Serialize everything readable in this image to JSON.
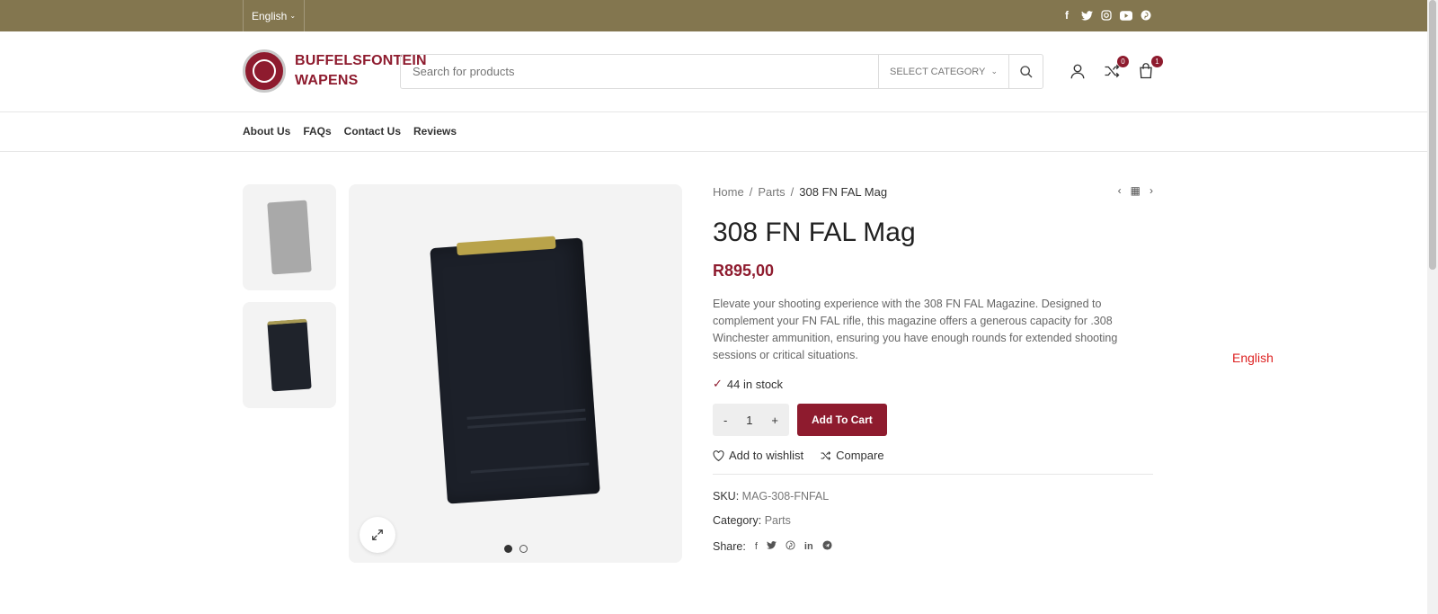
{
  "topbar": {
    "language": "English",
    "socials": [
      "facebook-icon",
      "twitter-icon",
      "instagram-icon",
      "youtube-icon",
      "pinterest-icon"
    ]
  },
  "header": {
    "logo_line1": "BUFFELSFONTEIN",
    "logo_line2": "WAPENS",
    "search_placeholder": "Search for products",
    "category_label": "SELECT CATEGORY",
    "compare_count": "0",
    "cart_count": "1"
  },
  "nav": {
    "items": [
      "About Us",
      "FAQs",
      "Contact Us",
      "Reviews"
    ]
  },
  "breadcrumb": {
    "home": "Home",
    "sep1": "/",
    "parts": "Parts",
    "sep2": "/",
    "current": "308 FN FAL Mag"
  },
  "product": {
    "title": "308 FN FAL Mag",
    "price": "R895,00",
    "description": "Elevate your shooting experience with the 308 FN FAL Magazine. Designed to complement your FN FAL rifle, this magazine offers a generous capacity for .308 Winchester ammunition, ensuring you have enough rounds for extended shooting sessions or critical situations.",
    "stock": "44 in stock",
    "qty_minus": "-",
    "qty_value": "1",
    "qty_plus": "+",
    "add_to_cart": "Add To Cart",
    "wishlist": "Add to wishlist",
    "compare": "Compare",
    "sku_label": "SKU:",
    "sku_value": "MAG-308-FNFAL",
    "category_label": "Category:",
    "category_value": "Parts",
    "share_label": "Share:"
  },
  "floating_language": "English",
  "colors": {
    "topbar": "#83764f",
    "accent": "#8e1b2e"
  }
}
